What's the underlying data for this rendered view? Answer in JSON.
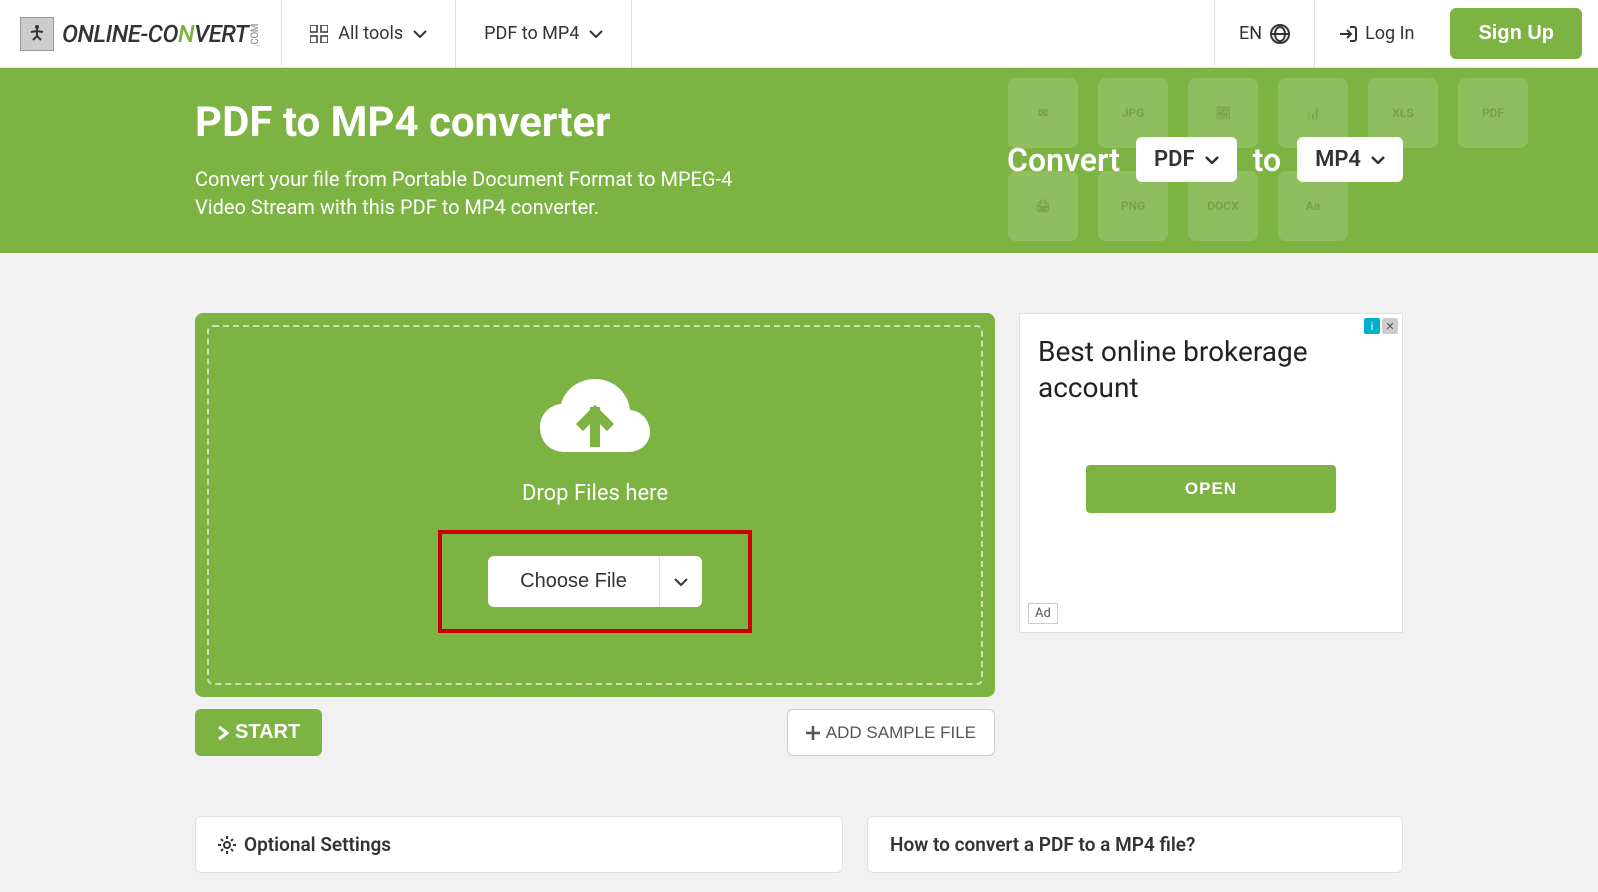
{
  "header": {
    "logo_text1": "ONLINE-",
    "logo_text2": "CO",
    "logo_text3": "N",
    "logo_text4": "VERT",
    "logo_com": ".COM",
    "all_tools": "All tools",
    "pdf_to_mp4": "PDF to MP4",
    "lang": "EN",
    "login": "Log In",
    "signup": "Sign Up"
  },
  "hero": {
    "title": "PDF to MP4 converter",
    "description": "Convert your file from Portable Document Format to MPEG-4 Video Stream with this PDF to MP4 converter.",
    "convert_label": "Convert",
    "to_label": "to",
    "from_format": "PDF",
    "to_format": "MP4"
  },
  "upload": {
    "drop_text": "Drop Files here",
    "choose_file": "Choose File",
    "start": "START",
    "add_sample": "ADD SAMPLE FILE"
  },
  "ad": {
    "title": "Best online brokerage account",
    "open": "OPEN",
    "label": "Ad"
  },
  "settings": {
    "title": "Optional Settings"
  },
  "howto": {
    "title": "How to convert a PDF to a MP4 file?"
  }
}
